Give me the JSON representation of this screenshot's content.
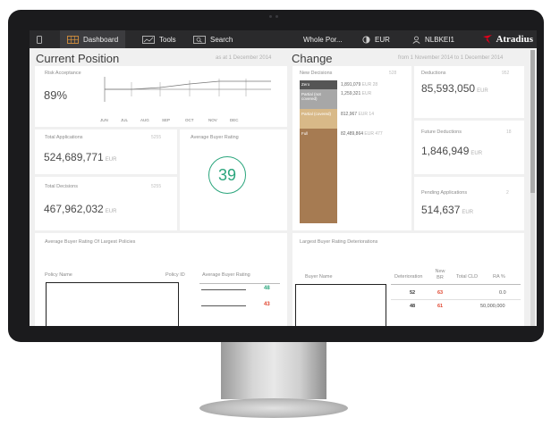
{
  "nav": {
    "dashboard": "Dashboard",
    "tools": "Tools",
    "search": "Search",
    "policy": "Whole Por...",
    "currency": "EUR",
    "user": "NLBKEI1",
    "brand": "Atradius",
    "brand_color": "#e3001b"
  },
  "current_position": {
    "title": "Current Position",
    "date": "as at 1 December 2014",
    "risk_acceptance": {
      "label": "Risk Acceptance",
      "value": "89%",
      "months": [
        "JUN",
        "JUL",
        "AUG",
        "SEP",
        "OCT",
        "NOV",
        "DEC"
      ]
    },
    "total_applications": {
      "label": "Total Applications",
      "count": "5255",
      "value": "524,689,771",
      "unit": "EUR"
    },
    "total_decisions": {
      "label": "Total Decisions",
      "count": "5255",
      "value": "467,962,032",
      "unit": "EUR"
    },
    "avg_buyer_rating": {
      "label": "Average Buyer Rating",
      "value": "39",
      "color": "#2aa57c"
    },
    "largest_policies": {
      "title": "Average Buyer Rating Of Largest Policies",
      "col_name": "Policy Name",
      "col_id": "Policy ID",
      "col_rating": "Average Buyer Rating",
      "ratings": [
        {
          "value": "48",
          "color": "#2aa57c"
        },
        {
          "value": "43",
          "color": "#e0452e"
        }
      ]
    }
  },
  "change": {
    "title": "Change",
    "date": "from 1 November 2014 to 1 December 2014",
    "new_decisions": {
      "label": "New Decisions",
      "count": "528",
      "rows": [
        {
          "name": "Zero",
          "value": "1,891,079",
          "unit": "EUR",
          "count": "28",
          "color": "#555555"
        },
        {
          "name": "Partial (not covered)",
          "value": "1,259,321",
          "unit": "EUR",
          "count": "",
          "color": "#a7a7a7"
        },
        {
          "name": "Partial (covered)",
          "value": "812,967",
          "unit": "EUR",
          "count": "14",
          "color": "#d8b988"
        },
        {
          "name": "Full",
          "value": "82,489,864",
          "unit": "EUR",
          "count": "477",
          "color": "#a67b52"
        }
      ]
    },
    "deductions": {
      "label": "Deductions",
      "count": "952",
      "value": "85,593,050",
      "unit": "EUR"
    },
    "future_deductions": {
      "label": "Future Deductions",
      "count": "18",
      "value": "1,846,949",
      "unit": "EUR"
    },
    "pending_applications": {
      "label": "Pending Applications",
      "count": "2",
      "value": "514,637",
      "unit": "EUR"
    },
    "deteriorations": {
      "title": "Largest Buyer Rating Deteriorations",
      "col_buyer": "Buyer Name",
      "col_det": "Deterioration",
      "col_new": "New BR",
      "col_cld": "Total CLD",
      "col_ra": "RA %",
      "rows": [
        {
          "det": "52",
          "new": "63",
          "cld": "",
          "ra": "0.0"
        },
        {
          "det": "48",
          "new": "61",
          "cld": "50,000,000",
          "ra": ""
        }
      ]
    }
  }
}
